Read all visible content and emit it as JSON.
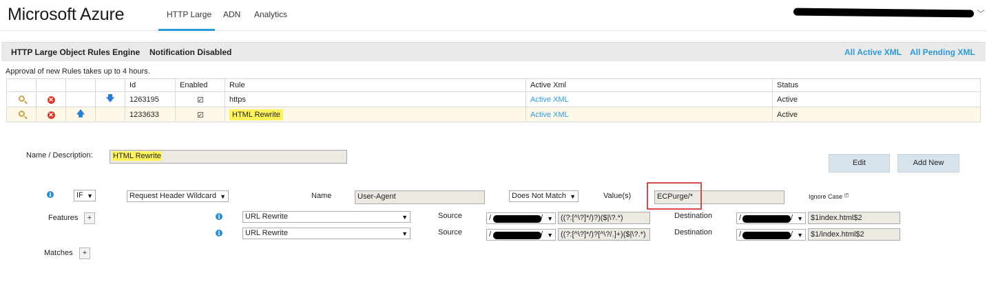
{
  "brand": "Microsoft Azure",
  "nav": {
    "tabs": [
      {
        "label": "HTTP Large",
        "active": true
      },
      {
        "label": "ADN",
        "active": false
      },
      {
        "label": "Analytics",
        "active": false
      }
    ],
    "account_chevron": "﹀"
  },
  "header": {
    "title": "HTTP Large Object Rules Engine",
    "notification": "Notification Disabled",
    "link_active_xml": "All Active XML",
    "link_pending_xml": "All Pending XML"
  },
  "approval_note": "Approval of new Rules takes up to 4 hours.",
  "table": {
    "columns": [
      "Id",
      "Enabled",
      "Rule",
      "Active Xml",
      "Status"
    ],
    "rows": [
      {
        "id": "1263195",
        "enabled": true,
        "rule": "https",
        "active_xml": "Active XML",
        "status": "Active",
        "move": "down"
      },
      {
        "id": "1233633",
        "enabled": true,
        "rule": "HTML Rewrite",
        "active_xml": "Active XML",
        "status": "Active",
        "move": "up"
      }
    ]
  },
  "editor": {
    "name_label": "Name / Description:",
    "name_value": "HTML Rewrite",
    "edit_button": "Edit",
    "add_new_button": "Add New",
    "condition": {
      "if_select": "IF",
      "match_type": "Request Header Wildcard",
      "name_label": "Name",
      "name_value": "User-Agent",
      "operator": "Does Not Match",
      "values_label": "Value(s)",
      "values_value": "ECPurge/*",
      "ignore_case_label": "Ignore Case"
    },
    "features_label": "Features",
    "features": [
      {
        "type": "URL Rewrite",
        "source_label": "Source",
        "source_prefix": "/",
        "source_suffix": "/",
        "source_pattern": "((?:[^\\?]*/)?)($|\\?.*)",
        "dest_label": "Destination",
        "dest_prefix": "/",
        "dest_suffix": "/",
        "dest_value": "$1index.html$2"
      },
      {
        "type": "URL Rewrite",
        "source_label": "Source",
        "source_prefix": "/",
        "source_suffix": "/",
        "source_pattern": "((?:[^\\?]*/)?[^\\?/.]+)($|\\?.*)",
        "dest_label": "Destination",
        "dest_prefix": "/",
        "dest_suffix": "/",
        "dest_value": "$1/index.html$2"
      }
    ],
    "matches_label": "Matches",
    "plus": "+"
  },
  "colors": {
    "accent": "#2a9bd8",
    "highlight": "#fff35c",
    "annotation_box": "#d94a4a"
  }
}
